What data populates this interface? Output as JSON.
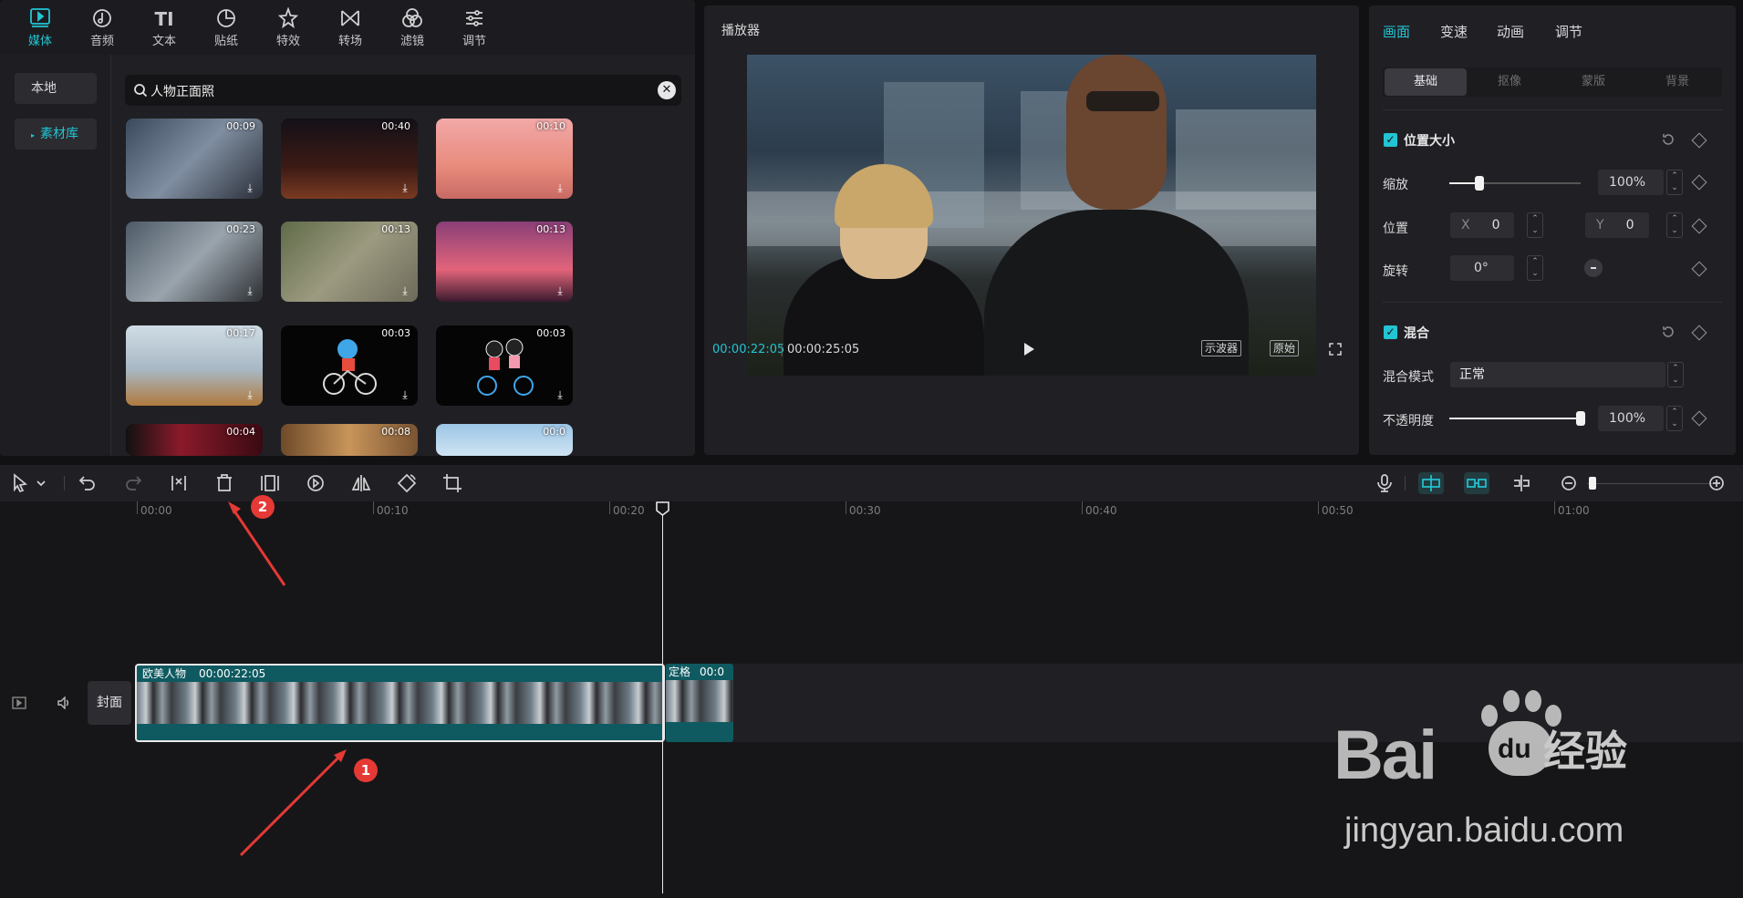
{
  "media": {
    "tabs": [
      {
        "label": "媒体",
        "icon": "media-icon"
      },
      {
        "label": "音频",
        "icon": "audio-icon"
      },
      {
        "label": "文本",
        "icon": "text-icon"
      },
      {
        "label": "贴纸",
        "icon": "sticker-icon"
      },
      {
        "label": "特效",
        "icon": "effects-icon"
      },
      {
        "label": "转场",
        "icon": "transition-icon"
      },
      {
        "label": "滤镜",
        "icon": "filter-icon"
      },
      {
        "label": "调节",
        "icon": "adjust-icon"
      }
    ],
    "nav": [
      {
        "label": "本地"
      },
      {
        "label": "素材库"
      }
    ],
    "search": {
      "value": "人物正面照"
    },
    "thumbnails": [
      {
        "duration": "00:09"
      },
      {
        "duration": "00:40"
      },
      {
        "duration": "00:10"
      },
      {
        "duration": "00:23"
      },
      {
        "duration": "00:13"
      },
      {
        "duration": "00:13"
      },
      {
        "duration": "00:17"
      },
      {
        "duration": "00:03"
      },
      {
        "duration": "00:03"
      },
      {
        "duration": "00:04"
      },
      {
        "duration": "00:08"
      },
      {
        "duration": "00:0"
      }
    ]
  },
  "player": {
    "title": "播放器",
    "current_time": "00:00:22:05",
    "total_time": "00:00:25:05",
    "scope_label": "示波器",
    "ratio_label": "原始"
  },
  "props": {
    "tabs": [
      "画面",
      "变速",
      "动画",
      "调节"
    ],
    "segments": [
      "基础",
      "抠像",
      "蒙版",
      "背景"
    ],
    "position_section": "位置大小",
    "scale_label": "缩放",
    "scale_value": "100%",
    "scale_fraction": 0.23,
    "position_label": "位置",
    "x_label": "X",
    "x_value": "0",
    "y_label": "Y",
    "y_value": "0",
    "rotate_label": "旋转",
    "rotate_value": "0°",
    "blend_section": "混合",
    "blend_mode_label": "混合模式",
    "blend_mode_value": "正常",
    "opacity_label": "不透明度",
    "opacity_value": "100%",
    "opacity_fraction": 1.0
  },
  "timeline": {
    "ticks": [
      "00:00",
      "00:10",
      "00:20",
      "00:30",
      "00:40",
      "00:50",
      "01:00"
    ],
    "cover_label": "封面",
    "clip_name": "欧美人物",
    "clip_duration": "00:00:22:05",
    "clip2_name": "定格",
    "clip2_duration": "00:0"
  },
  "annotations": {
    "marker1": "1",
    "marker2": "2"
  },
  "watermark": {
    "brand": "Bai",
    "brand2": "du",
    "brand_cn": "经验",
    "url": "jingyan.baidu.com"
  },
  "colors": {
    "accent": "#22c5d3",
    "clip": "#0f5a60",
    "marker": "#e53935"
  }
}
